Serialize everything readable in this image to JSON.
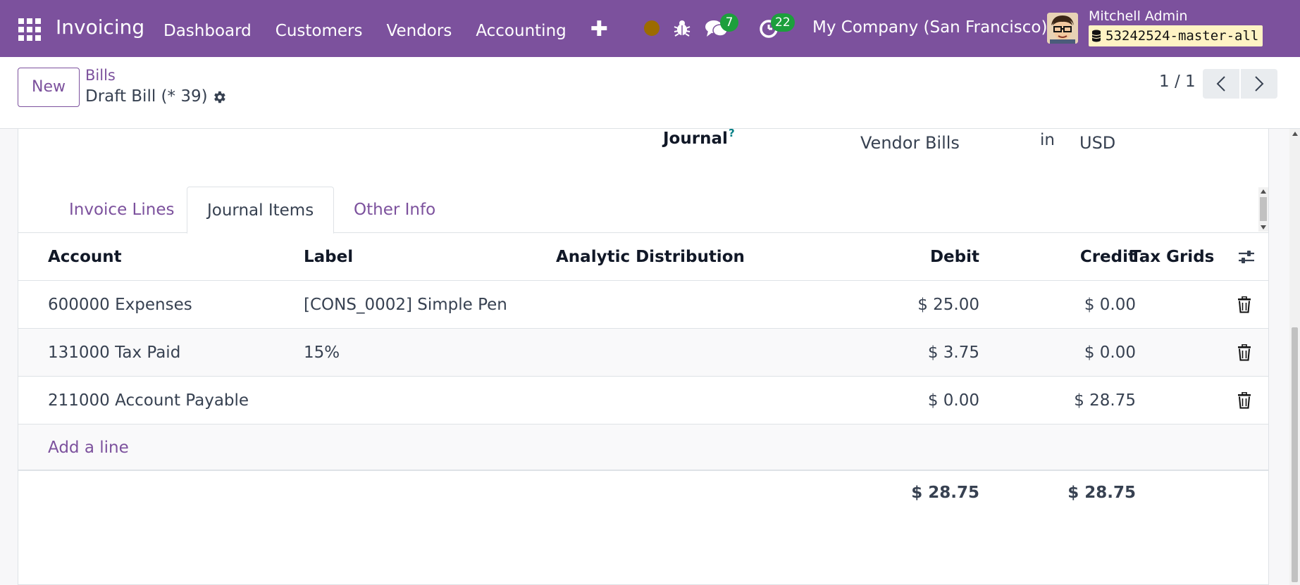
{
  "navbar": {
    "app_name": "Invoicing",
    "menu": [
      "Dashboard",
      "Customers",
      "Vendors",
      "Accounting"
    ],
    "plus_label": "✚",
    "chat_count": "7",
    "activity_count": "22",
    "company": "My Company (San Francisco)",
    "user_name": "Mitchell Admin",
    "database": "53242524-master-all",
    "icons": [
      "apps-grid-icon",
      "status-dot-icon",
      "bug-icon",
      "chat-icon",
      "activity-clock-icon",
      "database-icon"
    ]
  },
  "control_panel": {
    "new_label": "New",
    "breadcrumb_parent": "Bills",
    "record_name": "Draft Bill (* 39)",
    "pager_value": "1 / 1"
  },
  "form": {
    "journal_label": "Journal",
    "journal_help": "?",
    "journal_value": "Vendor Bills",
    "journal_in": "in",
    "journal_currency": "USD"
  },
  "tabs": [
    {
      "label": "Invoice Lines",
      "active": false
    },
    {
      "label": "Journal Items",
      "active": true
    },
    {
      "label": "Other Info",
      "active": false
    }
  ],
  "table": {
    "headers": {
      "account": "Account",
      "label": "Label",
      "analytic": "Analytic Distribution",
      "debit": "Debit",
      "credit": "Credit",
      "tax_grids": "Tax Grids"
    },
    "rows": [
      {
        "account": "600000 Expenses",
        "label": "[CONS_0002] Simple Pen",
        "debit": "$ 25.00",
        "credit": "$ 0.00"
      },
      {
        "account": "131000 Tax Paid",
        "label": "15%",
        "debit": "$ 3.75",
        "credit": "$ 0.00"
      },
      {
        "account": "211000 Account Payable",
        "label": "",
        "debit": "$ 0.00",
        "credit": "$ 28.75"
      }
    ],
    "add_line": "Add a line",
    "totals": {
      "debit": "$ 28.75",
      "credit": "$ 28.75"
    }
  },
  "colors": {
    "brand": "#7c519d",
    "badge_green": "#1c9f3c",
    "db_badge_bg": "#fff3c4",
    "status_dot": "#9c6b00"
  }
}
